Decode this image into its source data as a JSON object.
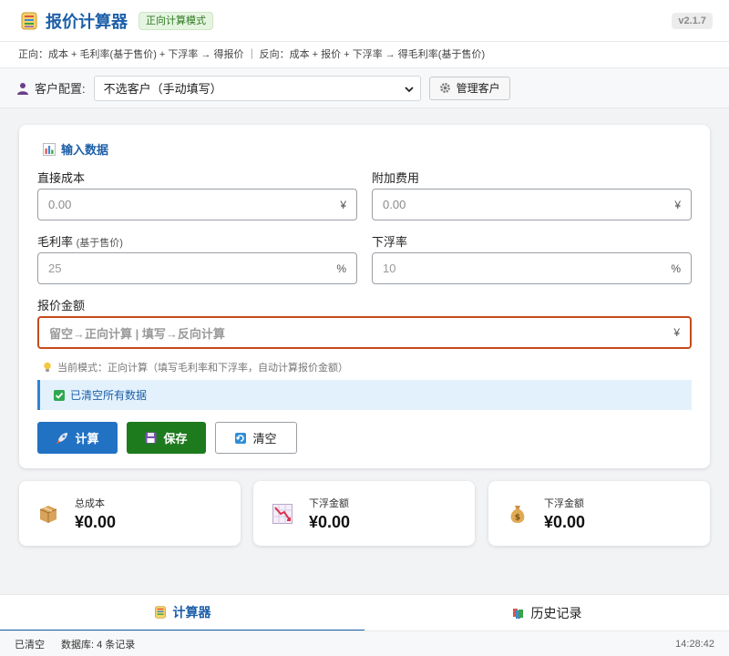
{
  "header": {
    "title": "报价计算器",
    "mode_badge": "正向计算模式",
    "version": "v2.1.7"
  },
  "formula_text": "正向：成本 + 毛利率(基于售价) + 下浮率 → 得报价 ｜ 反向：成本 + 报价 + 下浮率 → 得毛利率(基于售价)",
  "customer": {
    "label": "客户配置:",
    "selected": "不选客户（手动填写）",
    "manage_label": "管理客户"
  },
  "input_section": {
    "title": "输入数据",
    "direct_cost": {
      "label": "直接成本",
      "placeholder": "0.00",
      "unit": "¥"
    },
    "extra_cost": {
      "label": "附加费用",
      "placeholder": "0.00",
      "unit": "¥"
    },
    "margin": {
      "label": "毛利率",
      "label_note": "(基于售价)",
      "value": "25",
      "unit": "%"
    },
    "discount": {
      "label": "下浮率",
      "value": "10",
      "unit": "%"
    },
    "quote": {
      "label": "报价金额",
      "placeholder": "留空→正向计算 | 填写→反向计算",
      "unit": "¥"
    },
    "hint": "当前模式：正向计算（填写毛利率和下浮率，自动计算报价金额）",
    "notice": "已清空所有数据"
  },
  "buttons": {
    "calc": "计算",
    "save": "保存",
    "clear": "清空"
  },
  "stats": [
    {
      "label": "总成本",
      "value": "¥0.00",
      "icon": "package-icon"
    },
    {
      "label": "下浮金额",
      "value": "¥0.00",
      "icon": "chart-down-icon"
    },
    {
      "label": "下浮金额",
      "value": "¥0.00",
      "icon": "money-bag-icon"
    }
  ],
  "tabs": {
    "calculator": "计算器",
    "history": "历史记录"
  },
  "status": {
    "left": "已清空",
    "db": "数据库: 4 条记录",
    "time": "14:28:42"
  },
  "colors": {
    "primary": "#2272c3",
    "title": "#1d5fa8",
    "save": "#1d7a1d",
    "quote_border": "#c64a1a"
  }
}
